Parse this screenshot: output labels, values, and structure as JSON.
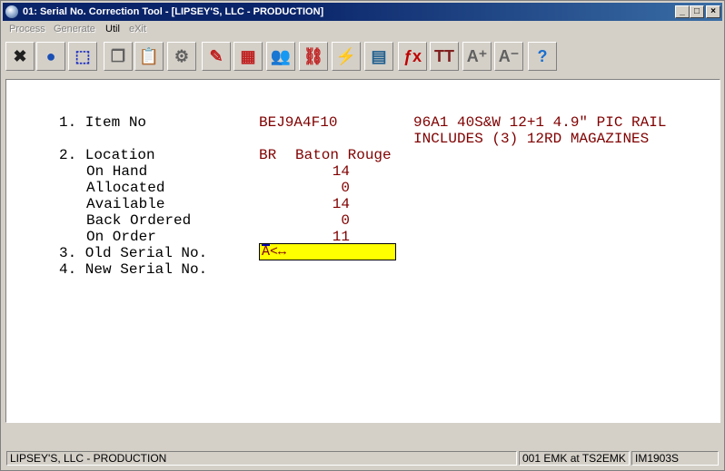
{
  "window": {
    "title": "01: Serial No. Correction Tool - [LIPSEY'S, LLC - PRODUCTION]",
    "min": "_",
    "max": "□",
    "close": "×"
  },
  "menu": [
    "Process",
    "Generate",
    "Util",
    "eXit"
  ],
  "toolbar": [
    {
      "name": "exit-icon",
      "glyph": "✖",
      "color": "#202020"
    },
    {
      "name": "globe-icon",
      "glyph": "●",
      "color": "#1a4fb4"
    },
    {
      "name": "select-icon",
      "glyph": "⬚",
      "color": "#2030c0"
    },
    {
      "name": "copy-icon",
      "glyph": "❐",
      "color": "#606060"
    },
    {
      "name": "paste-icon",
      "glyph": "📋",
      "color": "#806020"
    },
    {
      "name": "settings-icon",
      "glyph": "⚙",
      "color": "#606060"
    },
    {
      "name": "edit-icon",
      "glyph": "✎",
      "color": "#c02020"
    },
    {
      "name": "table-icon",
      "glyph": "▦",
      "color": "#c02020"
    },
    {
      "name": "users-icon",
      "glyph": "👥",
      "color": "#2a7ac0"
    },
    {
      "name": "link-icon",
      "glyph": "⛓",
      "color": "#c02020"
    },
    {
      "name": "lightning-icon",
      "glyph": "⚡",
      "color": "#e0c000"
    },
    {
      "name": "calendar-icon",
      "glyph": "▤",
      "color": "#206090"
    },
    {
      "name": "function-icon",
      "glyph": "ƒx",
      "color": "#c00000"
    },
    {
      "name": "font-size-icon",
      "glyph": "TT",
      "color": "#802020"
    },
    {
      "name": "font-increase-icon",
      "glyph": "A⁺",
      "color": "#606060"
    },
    {
      "name": "font-decrease-icon",
      "glyph": "A⁻",
      "color": "#606060"
    },
    {
      "name": "help-icon",
      "glyph": "?",
      "color": "#1a6fd0"
    }
  ],
  "form": {
    "item_no": {
      "label": "1. Item No",
      "value": "BEJ9A4F10",
      "desc1": "96A1 40S&W 12+1 4.9\" PIC RAIL",
      "desc2": "INCLUDES (3) 12RD MAGAZINES"
    },
    "location": {
      "label": "2. Location",
      "code": "BR",
      "name": "Baton Rouge"
    },
    "on_hand": {
      "label": "On Hand",
      "value": "14"
    },
    "allocated": {
      "label": "Allocated",
      "value": "0"
    },
    "available": {
      "label": "Available",
      "value": "14"
    },
    "back_ordered": {
      "label": "Back Ordered",
      "value": "0"
    },
    "on_order": {
      "label": "On Order",
      "value": "11"
    },
    "old_serial": {
      "label": "3. Old Serial No.",
      "value": "A<↔"
    },
    "new_serial": {
      "label": "4. New Serial No."
    }
  },
  "status": {
    "company": "LIPSEY'S, LLC - PRODUCTION",
    "session": "001 EMK at TS2EMK",
    "program": "IM1903S"
  }
}
